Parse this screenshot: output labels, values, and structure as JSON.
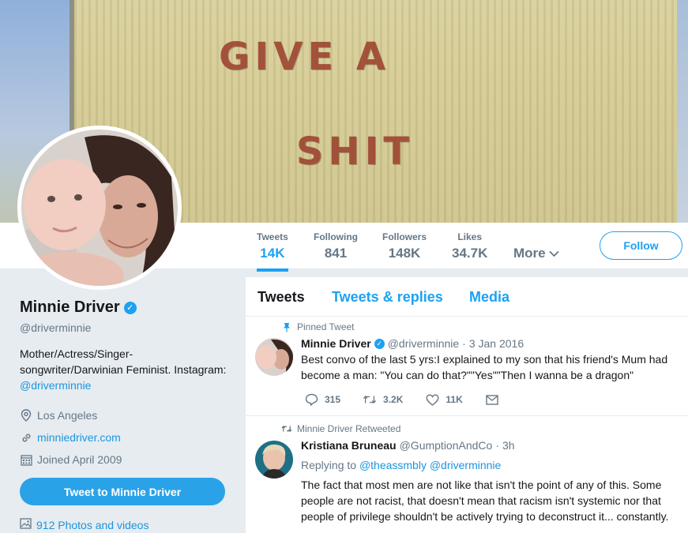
{
  "banner": {
    "line1": "GIVE A",
    "line2": "SHIT"
  },
  "nav": {
    "stats": [
      {
        "label": "Tweets",
        "value": "14K"
      },
      {
        "label": "Following",
        "value": "841"
      },
      {
        "label": "Followers",
        "value": "148K"
      },
      {
        "label": "Likes",
        "value": "34.7K"
      }
    ],
    "more_label": "More",
    "follow_label": "Follow"
  },
  "profile": {
    "name": "Minnie Driver",
    "screen_name": "@driverminnie",
    "bio_text": "Mother/Actress/Singer-songwriter/Darwinian Feminist. Instagram: ",
    "bio_link": "@driverminnie",
    "location": "Los Angeles",
    "website": "minniedriver.com",
    "joined": "Joined April 2009",
    "tweet_to_label": "Tweet to Minnie Driver",
    "photos_label": "912 Photos and videos"
  },
  "timeline": {
    "tabs": [
      "Tweets",
      "Tweets & replies",
      "Media"
    ],
    "tweets": [
      {
        "context": "Pinned Tweet",
        "name": "Minnie Driver",
        "handle": "@driverminnie",
        "time": "3 Jan 2016",
        "text": "Best convo of the last 5 yrs:I explained to my son that his friend's Mum had become a man: \"You can do that?\"\"Yes\"\"Then I wanna be a dragon\"",
        "replies": "315",
        "retweets": "3.2K",
        "likes": "11K"
      },
      {
        "context": "Minnie Driver Retweeted",
        "name": "Kristiana Bruneau",
        "handle": "@GumptionAndCo",
        "time": "3h",
        "replying_label": "Replying to",
        "replying_handles": "@theassmbly @driverminnie",
        "text": "The fact that most men are not like that isn't the point of any of this. Some people are not racist, that doesn't mean that racism isn't systemic nor that people of privilege shouldn't be actively trying to deconstruct it... constantly."
      }
    ]
  },
  "colors": {
    "accent": "#1da1f2",
    "secondary_text": "#657786",
    "background": "#e6ecf0"
  },
  "icons": {
    "verified": "verified-badge-icon",
    "location": "map-pin-icon",
    "website": "link-icon",
    "joined": "calendar-icon",
    "photos": "image-icon",
    "pin": "pin-icon",
    "retweet": "retweet-icon",
    "reply": "reply-icon",
    "like": "heart-icon",
    "dm": "envelope-icon"
  }
}
